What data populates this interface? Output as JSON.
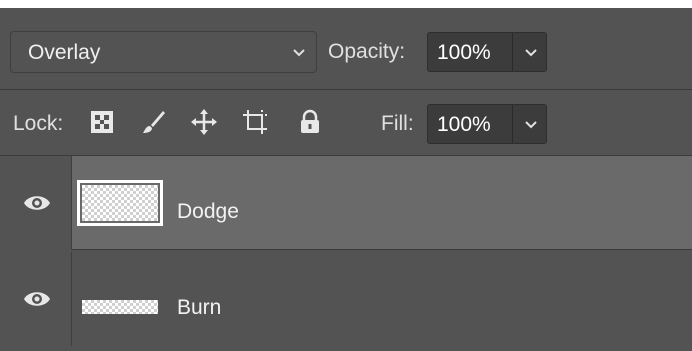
{
  "blend_mode": {
    "value": "Overlay",
    "icon": "chevron-down-icon"
  },
  "opacity": {
    "label": "Opacity:",
    "value": "100%",
    "icon": "chevron-down-icon"
  },
  "lock": {
    "label": "Lock:",
    "icons": [
      "lock-transparent-pixels-icon",
      "lock-image-pixels-icon",
      "lock-position-icon",
      "lock-artboard-icon",
      "lock-all-icon"
    ]
  },
  "fill": {
    "label": "Fill:",
    "value": "100%",
    "icon": "chevron-down-icon"
  },
  "layers": [
    {
      "name": "Dodge",
      "visible": true,
      "selected": true,
      "icon": "eye-icon"
    },
    {
      "name": "Burn",
      "visible": true,
      "selected": false,
      "icon": "eye-icon"
    }
  ],
  "colors": {
    "panel": "#535353",
    "selected_row": "#6a6a6a",
    "field": "#3c3c3c",
    "text": "#e8e8e8"
  }
}
